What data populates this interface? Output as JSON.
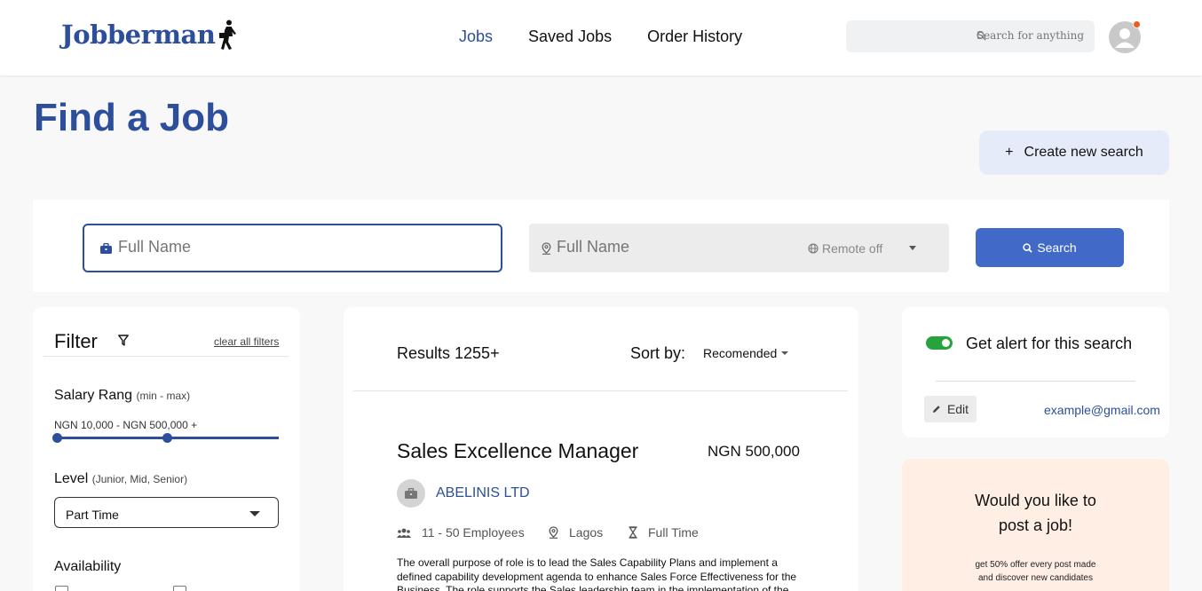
{
  "header": {
    "logo_text": "Jobberman",
    "nav": [
      "Jobs",
      "Saved Jobs",
      "Order History"
    ],
    "search_placeholder": "Search for anything"
  },
  "page": {
    "title": "Find a Job",
    "create_search_label": "Create new search"
  },
  "search": {
    "job_placeholder": "Full Name",
    "location_placeholder": "Full Name",
    "remote_label": "Remote off",
    "button_label": "Search"
  },
  "filter": {
    "title": "Filter",
    "clear_label": "clear all filters",
    "salary_label": "Salary Rang",
    "salary_hint": "(min - max)",
    "salary_range": "NGN 10,000 - NGN 500,000 +",
    "level_label": "Level",
    "level_hint": "(Junior, Mid, Senior)",
    "level_value": "Part Time",
    "availability_label": "Availability"
  },
  "results": {
    "count_label": "Results 1255+",
    "sort_label": "Sort by:",
    "sort_value": "Recomended",
    "job": {
      "title": "Sales Excellence Manager",
      "salary": "NGN 500,000",
      "company": "ABELINIS LTD",
      "employees": "11 - 50 Employees",
      "location": "Lagos",
      "type": "Full Time",
      "description": "The overall purpose of role is to lead the Sales Capability Plans and implement a defined capability development agenda to enhance Sales Force Effectiveness for the Business. The role supports the Sales leadership team in the implementation of the"
    }
  },
  "alert": {
    "label": "Get alert for this search",
    "edit_label": "Edit",
    "email": "example@gmail.com",
    "enabled": true
  },
  "promo": {
    "title_line1": "Would you like to",
    "title_line2": "post a job!",
    "sub_line1": "get 50% offer every post made",
    "sub_line2": "and discover new candidates"
  },
  "colors": {
    "brand": "#2c4e9b",
    "button": "#4169c7",
    "toggle": "#27a33d",
    "notification": "#f05a1a",
    "promo_bg": "#feeee3"
  }
}
